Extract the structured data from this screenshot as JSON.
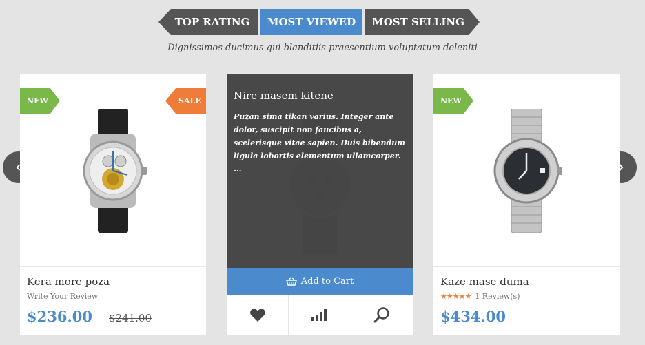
{
  "tabs": [
    {
      "label": "TOP RATING",
      "active": false
    },
    {
      "label": "MOST VIEWED",
      "active": true
    },
    {
      "label": "MOST SELLING",
      "active": false
    }
  ],
  "subtitle": "Dignissimos ducimus qui blanditiis praesentium voluptatum deleniti",
  "colors": {
    "accent": "#4a8acd",
    "tab_dark": "#555555",
    "badge_new": "#7ab84a",
    "badge_sale": "#f07c3a",
    "overlay": "#484848",
    "background": "#e4e4e4"
  },
  "products": [
    {
      "name": "Kera more poza",
      "review_link": "Write Your Review",
      "price": "$236.00",
      "old_price": "$241.00",
      "badges": [
        "NEW",
        "SALE"
      ],
      "image_icon": "skeleton-watch-icon"
    },
    {
      "name": "Nire masem kitene",
      "description": "Puzan sima tikan varius. Integer ante dolor, suscipit non faucibus a, scelerisque vitae sapien. Duis bibendum ligula lobortis elementum ullamcorper. ...",
      "add_to_cart": "Add to Cart",
      "actions": [
        "heart-icon",
        "compare-icon",
        "search-icon"
      ],
      "image_icon": "dark-chronograph-watch-icon"
    },
    {
      "name": "Kaze mase duma",
      "rating": 5,
      "rating_text": "1 Review(s)",
      "price": "$434.00",
      "badges": [
        "NEW"
      ],
      "image_icon": "steel-watch-icon"
    }
  ],
  "nav": {
    "prev_icon": "chevron-left-icon",
    "next_icon": "chevron-right-icon"
  }
}
